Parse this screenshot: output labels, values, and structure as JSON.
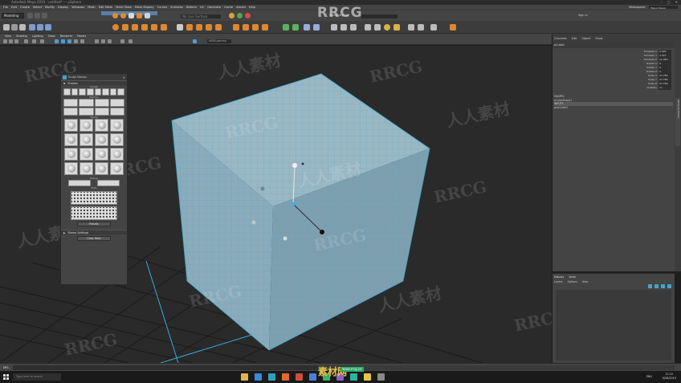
{
  "window": {
    "title": "Autodesk Maya 2019 - untitled* --- pSphere",
    "controls": [
      "–",
      "▢",
      "✕"
    ]
  },
  "menus": [
    "File",
    "Edit",
    "Create",
    "Select",
    "Modify",
    "Display",
    "Windows",
    "Mesh",
    "Edit Mesh",
    "Mesh Tools",
    "Mesh Display",
    "Curves",
    "Surfaces",
    "Deform",
    "UV",
    "Generate",
    "Cache",
    "Arnold",
    "Help"
  ],
  "workspace": {
    "label": "Workspace:",
    "value": "Maya Classic"
  },
  "status_line": {
    "mode": "Modeling",
    "search_placeholder": "No Live Surface",
    "symmetry_label": "Symmetry: Off",
    "signin": "Sign In"
  },
  "panel_menu": [
    "View",
    "Shading",
    "Lighting",
    "Show",
    "Renderer",
    "Panels"
  ],
  "viewport_toolbar": {
    "camera_field": "sRGB gamma"
  },
  "sculpt_panel": {
    "title": "Sculpt Stamps",
    "section_header": "Presets",
    "group_labels": [
      "Sculpt",
      "Stamps",
      "Stamp",
      "Stamp",
      "Tools"
    ],
    "apply_button": "Presets",
    "footer_section": "Stamp Settings",
    "footer_button": "Clear Paint"
  },
  "viewport_colors": {
    "cube_top": "#9ab7c4",
    "cube_left": "#8aabba",
    "cube_right": "#7e9fae",
    "wire": "#3ea6c8",
    "grid": "#1f1f1f",
    "axis": "#3aa7d8"
  },
  "channel_box": {
    "tabs": [
      "Channels",
      "Edit",
      "Object",
      "Show"
    ],
    "object_name": "pCube1",
    "attributes": [
      {
        "name": "Translate X",
        "value": "0.000"
      },
      {
        "name": "Translate Y",
        "value": "4.321"
      },
      {
        "name": "Translate Z",
        "value": "11.063"
      },
      {
        "name": "Rotate X",
        "value": "0"
      },
      {
        "name": "Rotate Y",
        "value": "0"
      },
      {
        "name": "Rotate Z",
        "value": "0"
      },
      {
        "name": "Scale X",
        "value": "27.780"
      },
      {
        "name": "Scale Y",
        "value": "27.780"
      },
      {
        "name": "Scale Z",
        "value": "27.780"
      },
      {
        "name": "Visibility",
        "value": "on"
      }
    ],
    "nodes_header": "SHAPES",
    "nodes": [
      "pCubeShape1",
      "INPUTS",
      "polyCube1"
    ]
  },
  "side_tab": "Attribute Editor",
  "layer_editor": {
    "tabs": [
      "Display",
      "Anim"
    ],
    "menu": [
      "Layers",
      "Options",
      "Help"
    ]
  },
  "command_line": {
    "label": "MEL"
  },
  "taskbar": {
    "search_placeholder": "Type here to search",
    "lang": "ENG",
    "time": "11:12",
    "date": "9/28/2019",
    "apps": [
      {
        "name": "file-explorer",
        "color": "#e0b54a"
      },
      {
        "name": "browser",
        "color": "#3a8ad8"
      },
      {
        "name": "maya",
        "color": "#2aa3b8"
      },
      {
        "name": "app-orange",
        "color": "#e26a2c"
      },
      {
        "name": "app-red",
        "color": "#d14d3d"
      },
      {
        "name": "app-blue",
        "color": "#4a7ed8"
      },
      {
        "name": "app-green",
        "color": "#3db06a"
      },
      {
        "name": "app-purple",
        "color": "#8b5fc9"
      },
      {
        "name": "app-teal",
        "color": "#2ab3a0"
      },
      {
        "name": "app-yellow",
        "color": "#e4c54a"
      },
      {
        "name": "app-gray",
        "color": "#888888"
      }
    ]
  },
  "watermarks": {
    "top": "RRCG",
    "latin": "RRCG",
    "cn": "人人素材",
    "bottom_logo": "素材网",
    "bottom_url": "www.rrcg.cn"
  }
}
